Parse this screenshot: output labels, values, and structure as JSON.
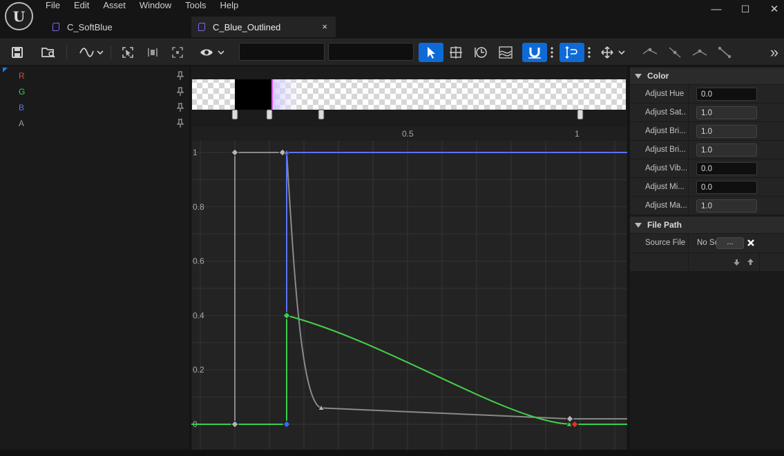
{
  "menu": [
    "File",
    "Edit",
    "Asset",
    "Window",
    "Tools",
    "Help"
  ],
  "tabs": [
    {
      "label": "C_SoftBlue",
      "active": false
    },
    {
      "label": "C_Blue_Outlined",
      "active": true,
      "close": "×"
    }
  ],
  "window_controls": {
    "minimize": "—",
    "maximize": "☐",
    "close": "✕"
  },
  "toolbar": {
    "overflow": "»"
  },
  "curves": [
    {
      "label": "R",
      "color": "#e04545"
    },
    {
      "label": "G",
      "color": "#37d24b"
    },
    {
      "label": "B",
      "color": "#5b73f5"
    },
    {
      "label": "A",
      "color": "#9a9a9a"
    }
  ],
  "graph": {
    "x_ticks": [
      "0.5",
      "1"
    ],
    "y_ticks": [
      "1",
      "0.8",
      "0.6",
      "0.4",
      "0.2",
      "0"
    ]
  },
  "details": {
    "color_section": "Color",
    "color_props": [
      {
        "name": "Adjust Hue",
        "value": "0.0"
      },
      {
        "name": "Adjust Sat...",
        "value": "1.0"
      },
      {
        "name": "Adjust Bri...",
        "value": "1.0"
      },
      {
        "name": "Adjust Bri...",
        "value": "1.0"
      },
      {
        "name": "Adjust Vib...",
        "value": "0.0"
      },
      {
        "name": "Adjust Mi...",
        "value": "0.0"
      },
      {
        "name": "Adjust Ma...",
        "value": "1.0"
      }
    ],
    "file_section": "File Path",
    "source_label": "Source File",
    "source_value": "No So",
    "browse_label": "..."
  },
  "chart_data": {
    "type": "line",
    "x_ticks": [
      0.5,
      1
    ],
    "y_ticks": [
      0,
      0.2,
      0.4,
      0.6,
      0.8,
      1
    ],
    "series": [
      {
        "name": "R",
        "color": "#e04545",
        "points": [
          [
            0.13,
            0
          ],
          [
            0.15,
            0
          ],
          [
            0.15,
            0.4
          ],
          [
            0.98,
            0.0
          ]
        ]
      },
      {
        "name": "G",
        "color": "#37d24b",
        "points": [
          [
            0.13,
            0
          ],
          [
            0.15,
            0
          ],
          [
            0.15,
            0.4
          ],
          [
            0.98,
            0.0
          ]
        ]
      },
      {
        "name": "B",
        "color": "#5b73f5",
        "points": [
          [
            0.13,
            0
          ],
          [
            0.15,
            0
          ],
          [
            0.15,
            1
          ],
          [
            1.06,
            1
          ]
        ]
      },
      {
        "name": "A",
        "color": "#8a8a8a",
        "points": [
          [
            0.0,
            0
          ],
          [
            0.0,
            1
          ],
          [
            0.15,
            1
          ],
          [
            0.25,
            0.06
          ],
          [
            0.97,
            0.02
          ]
        ]
      }
    ]
  }
}
